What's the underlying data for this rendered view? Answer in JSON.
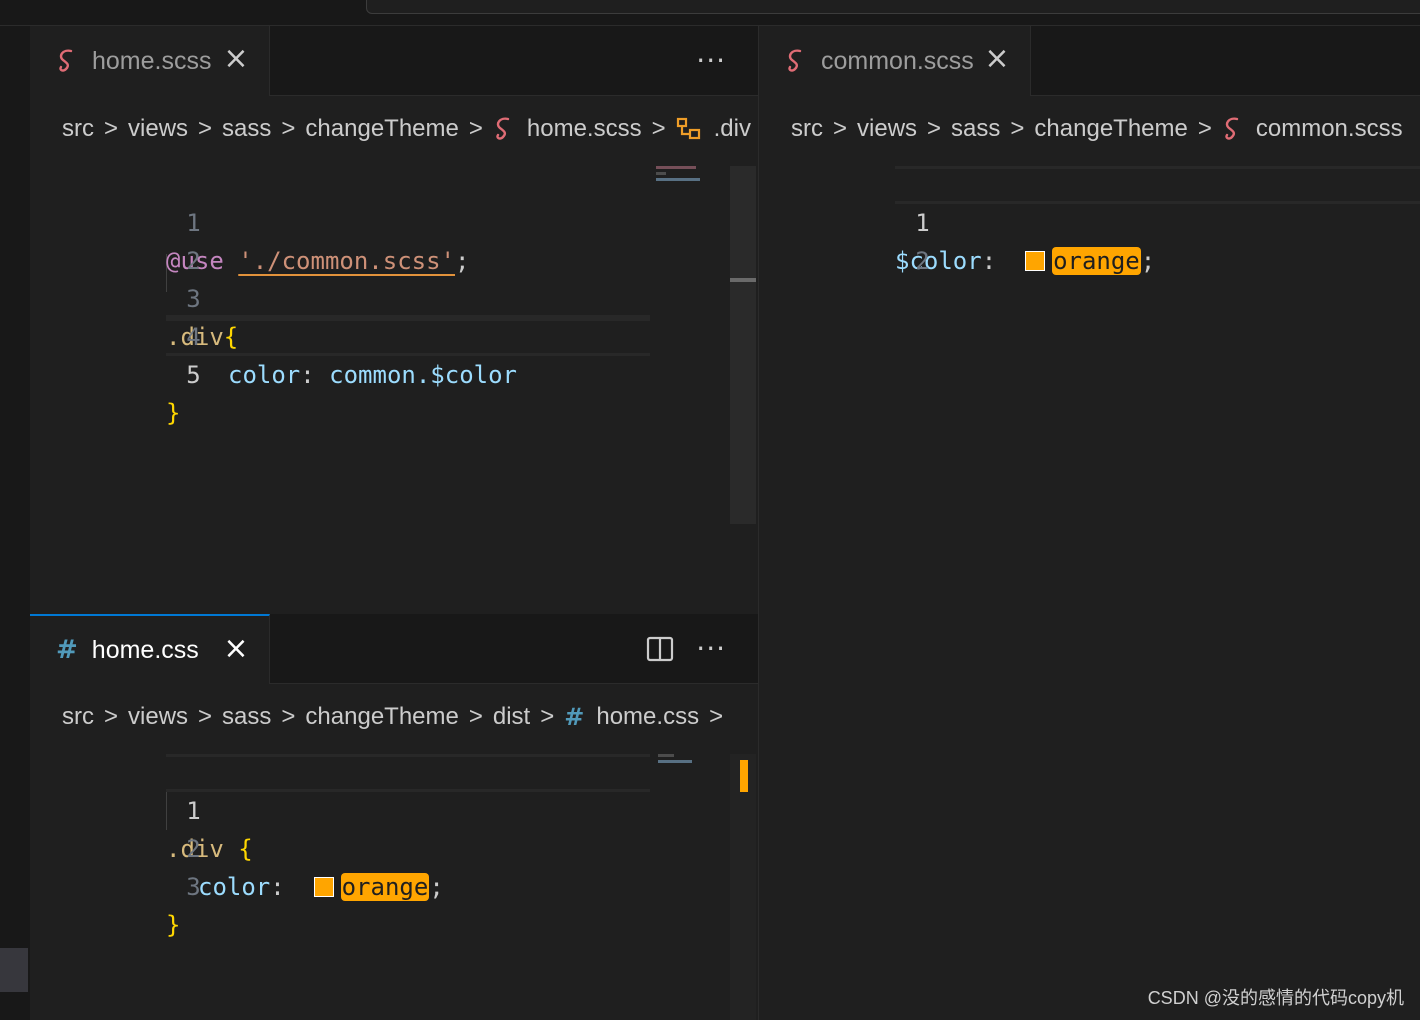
{
  "left_top": {
    "tab": {
      "label": "home.scss",
      "close": "×",
      "more": "···"
    },
    "breadcrumb": [
      "src",
      "views",
      "sass",
      "changeTheme",
      "home.scss",
      ".div"
    ],
    "lines": [
      {
        "num": "1",
        "use": "@use",
        "path": "'./common.scss'",
        "semi": ";"
      },
      {
        "num": "2"
      },
      {
        "num": "3",
        "selector": ".div",
        "brace": "{"
      },
      {
        "num": "4",
        "prop": "color",
        "colon": ":",
        "value": "common.$color"
      },
      {
        "num": "5",
        "brace": "}"
      }
    ]
  },
  "left_bottom": {
    "tab": {
      "label": "home.css",
      "close": "×",
      "more": "···"
    },
    "breadcrumb": [
      "src",
      "views",
      "sass",
      "changeTheme",
      "dist",
      "home.css"
    ],
    "lines": [
      {
        "num": "1",
        "selector": ".div",
        "brace": "{"
      },
      {
        "num": "2",
        "prop": "color",
        "colon": ":",
        "value": "orange",
        "semi": ";"
      },
      {
        "num": "3",
        "brace": "}"
      }
    ]
  },
  "right": {
    "tab": {
      "label": "common.scss",
      "close": "×"
    },
    "breadcrumb": [
      "src",
      "views",
      "sass",
      "changeTheme",
      "common.scss"
    ],
    "lines": [
      {
        "num": "1",
        "var": "$color",
        "colon": ":",
        "value": "orange",
        "semi": ";"
      },
      {
        "num": "2"
      }
    ]
  },
  "watermark": "CSDN @没的感情的代码copy机",
  "colors": {
    "accent": "#0078d4",
    "orange": "#ffa500",
    "sass": "#e06c75",
    "css": "#519aba"
  },
  "icons": {
    "sass": "sass-file-icon",
    "css": "css-hash-icon",
    "symbol": "symbol-structure-icon"
  }
}
